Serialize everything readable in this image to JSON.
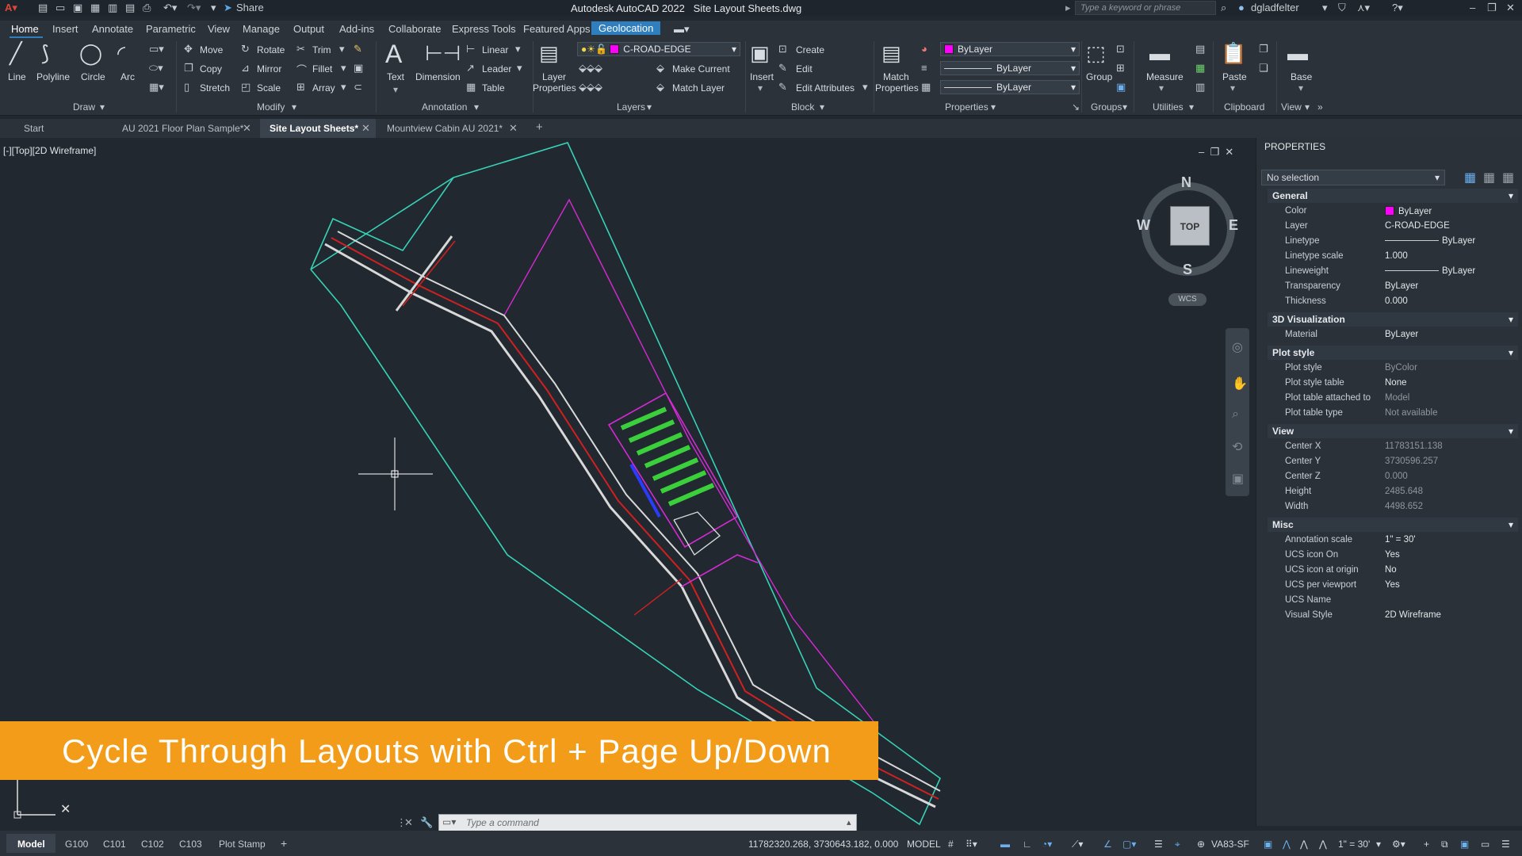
{
  "titlebar": {
    "app_title": "Autodesk AutoCAD 2022",
    "file_title": "Site Layout Sheets.dwg",
    "share_label": "Share",
    "search_placeholder": "Type a keyword or phrase",
    "user": "dgladfelter"
  },
  "menu": {
    "tabs": [
      "Home",
      "Insert",
      "Annotate",
      "Parametric",
      "View",
      "Manage",
      "Output",
      "Add-ins",
      "Collaborate",
      "Express Tools",
      "Featured Apps",
      "Geolocation"
    ]
  },
  "ribbon": {
    "draw": {
      "line": "Line",
      "polyline": "Polyline",
      "circle": "Circle",
      "arc": "Arc",
      "panel": "Draw"
    },
    "modify": {
      "move": "Move",
      "rotate": "Rotate",
      "trim": "Trim",
      "copy": "Copy",
      "mirror": "Mirror",
      "fillet": "Fillet",
      "stretch": "Stretch",
      "scale": "Scale",
      "array": "Array",
      "panel": "Modify"
    },
    "annotation": {
      "text": "Text",
      "dimension": "Dimension",
      "linear": "Linear",
      "leader": "Leader",
      "table": "Table",
      "panel": "Annotation"
    },
    "layers": {
      "properties": "Layer",
      "properties2": "Properties",
      "current_layer": "C-ROAD-EDGE",
      "make_current": "Make Current",
      "match_layer": "Match Layer",
      "panel": "Layers"
    },
    "block": {
      "insert": "Insert",
      "create": "Create",
      "edit": "Edit",
      "edit_attributes": "Edit Attributes",
      "panel": "Block"
    },
    "properties": {
      "match": "Match",
      "match2": "Properties",
      "color": "ByLayer",
      "linetype": "ByLayer",
      "lineweight": "ByLayer",
      "panel": "Properties"
    },
    "groups": {
      "group": "Group",
      "panel": "Groups"
    },
    "utilities": {
      "measure": "Measure",
      "panel": "Utilities"
    },
    "clipboard": {
      "paste": "Paste",
      "panel": "Clipboard"
    },
    "view": {
      "base": "Base",
      "panel": "View"
    }
  },
  "doc_tabs": [
    {
      "label": "Start"
    },
    {
      "label": "AU 2021 Floor Plan Sample*"
    },
    {
      "label": "Site Layout Sheets*"
    },
    {
      "label": "Mountview Cabin AU 2021*"
    }
  ],
  "viewport": {
    "label": "[-][Top][2D Wireframe]",
    "viewcube": {
      "n": "N",
      "s": "S",
      "e": "E",
      "w": "W",
      "top": "TOP",
      "wcs": "WCS"
    }
  },
  "properties_panel": {
    "title": "PROPERTIES",
    "selection": "No selection",
    "sections": {
      "general": "General",
      "viz": "3D Visualization",
      "plot": "Plot style",
      "view": "View",
      "misc": "Misc"
    },
    "general": [
      {
        "label": "Color",
        "value": "ByLayer"
      },
      {
        "label": "Layer",
        "value": "C-ROAD-EDGE"
      },
      {
        "label": "Linetype",
        "value": "ByLayer"
      },
      {
        "label": "Linetype scale",
        "value": "1.000"
      },
      {
        "label": "Lineweight",
        "value": "ByLayer"
      },
      {
        "label": "Transparency",
        "value": "ByLayer"
      },
      {
        "label": "Thickness",
        "value": "0.000"
      }
    ],
    "viz": [
      {
        "label": "Material",
        "value": "ByLayer"
      }
    ],
    "plot": [
      {
        "label": "Plot style",
        "value": "ByColor"
      },
      {
        "label": "Plot style table",
        "value": "None"
      },
      {
        "label": "Plot table attached to",
        "value": "Model"
      },
      {
        "label": "Plot table type",
        "value": "Not available"
      }
    ],
    "view": [
      {
        "label": "Center X",
        "value": "11783151.138"
      },
      {
        "label": "Center Y",
        "value": "3730596.257"
      },
      {
        "label": "Center Z",
        "value": "0.000"
      },
      {
        "label": "Height",
        "value": "2485.648"
      },
      {
        "label": "Width",
        "value": "4498.652"
      }
    ],
    "misc": [
      {
        "label": "Annotation scale",
        "value": "1\" = 30'"
      },
      {
        "label": "UCS icon On",
        "value": "Yes"
      },
      {
        "label": "UCS icon at origin",
        "value": "No"
      },
      {
        "label": "UCS per viewport",
        "value": "Yes"
      },
      {
        "label": "UCS Name",
        "value": ""
      },
      {
        "label": "Visual Style",
        "value": "2D Wireframe"
      }
    ]
  },
  "command": {
    "placeholder": "Type a command"
  },
  "banner": {
    "text": "Cycle Through Layouts with Ctrl + Page Up/Down"
  },
  "layout_tabs": [
    "Model",
    "G100",
    "C101",
    "C102",
    "C103",
    "Plot Stamp"
  ],
  "status": {
    "coords": "11782320.268, 3730643.182, 0.000",
    "mode": "MODEL",
    "coordsys": "VA83-SF",
    "scale": "1\" = 30'"
  },
  "colors": {
    "accent": "#2f7fbf",
    "banner": "#f39c1a",
    "layer_color": "#ff00ff"
  }
}
